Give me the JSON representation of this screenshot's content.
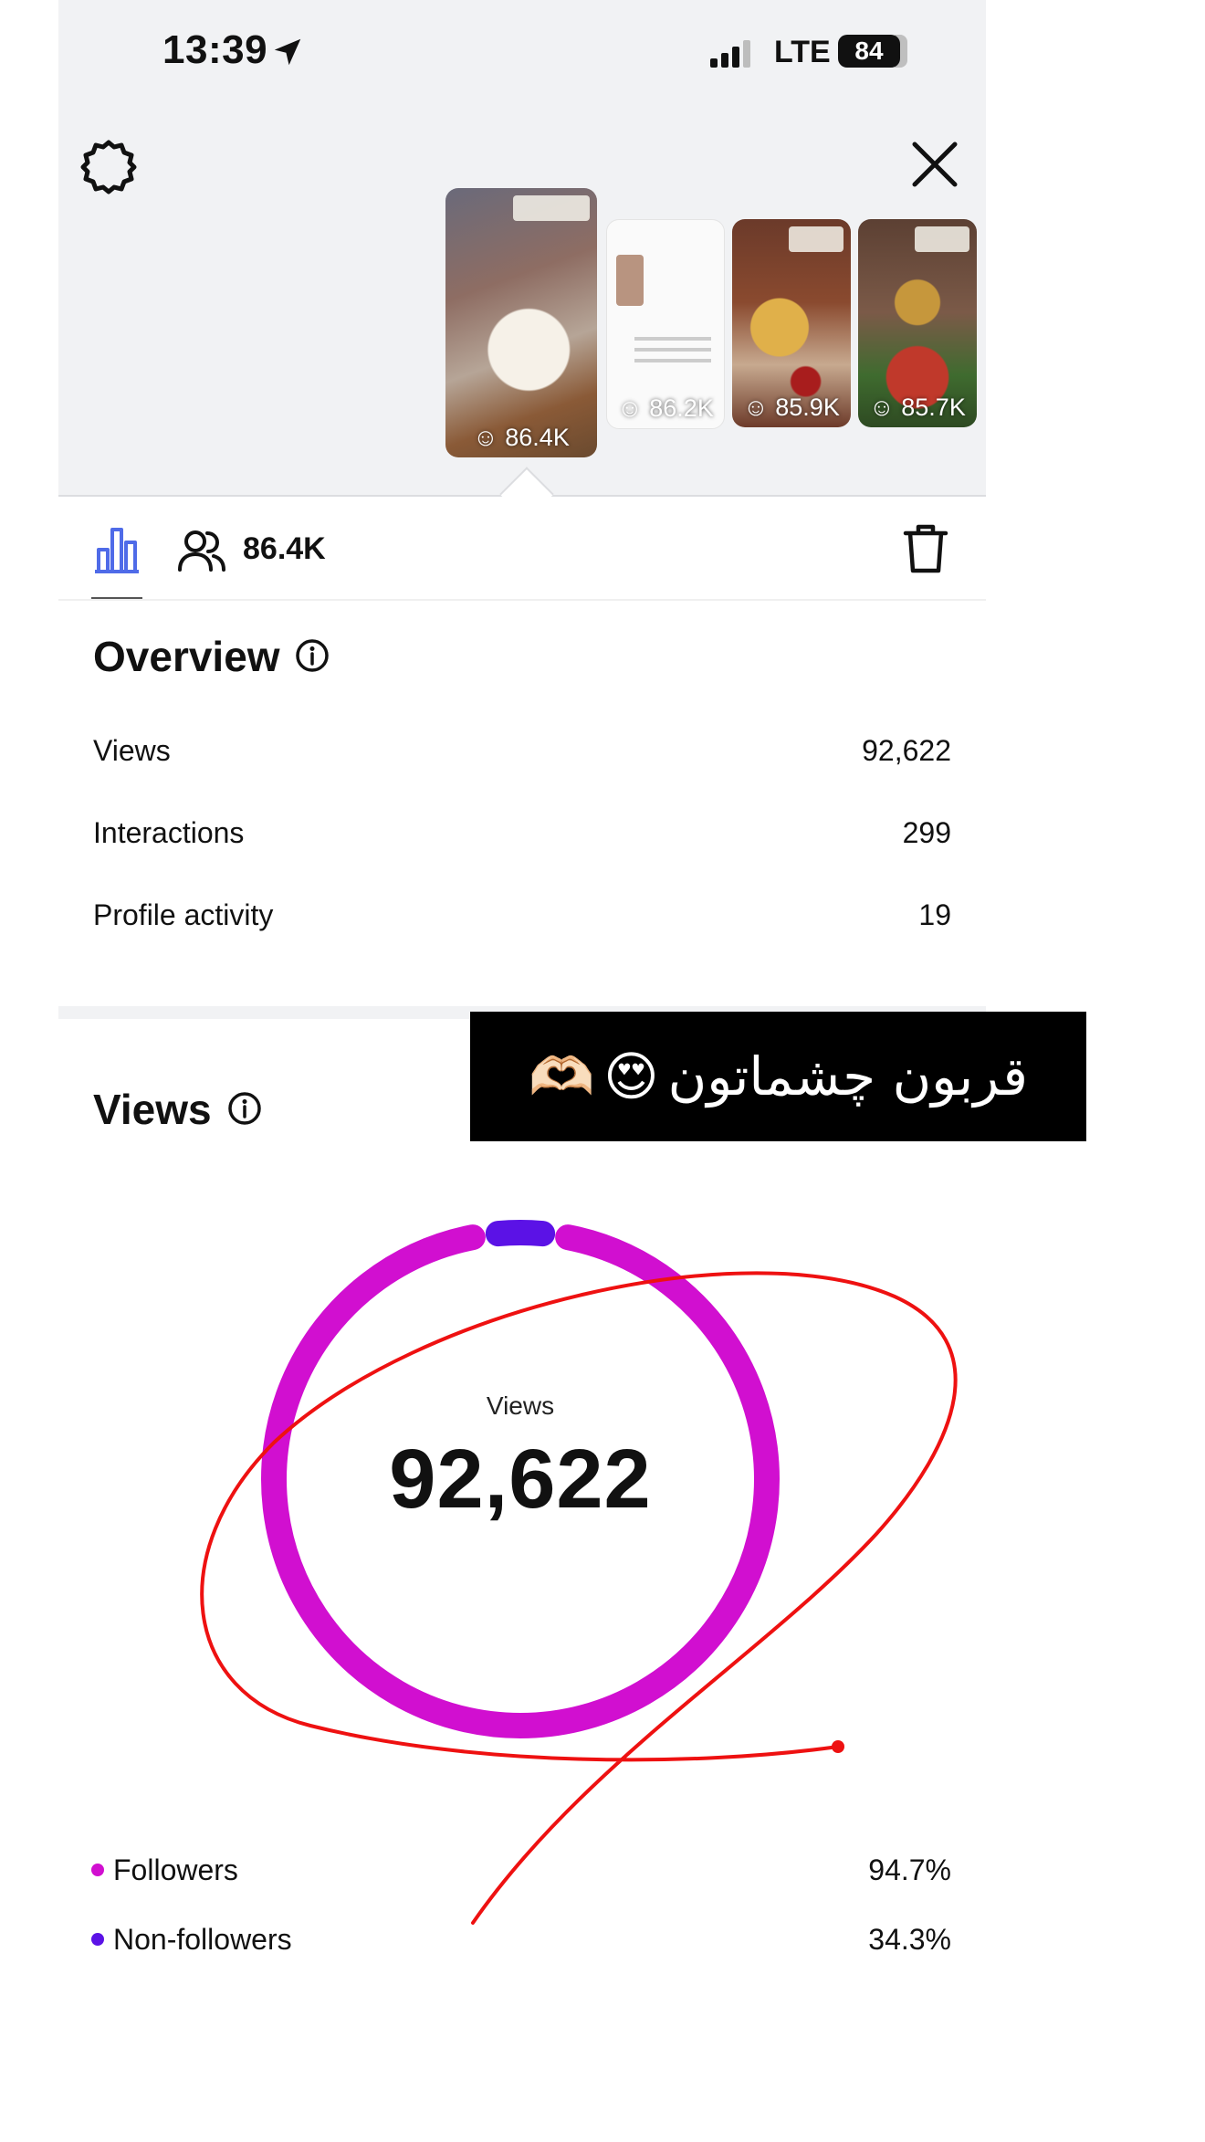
{
  "status_bar": {
    "time": "13:39",
    "network": "LTE",
    "battery": "84"
  },
  "icons": {
    "settings": "gear-icon",
    "close": "close-icon",
    "location": "location-arrow-icon",
    "signal": "signal-icon",
    "insights": "bar-chart-icon",
    "reach": "people-icon",
    "delete": "trash-icon",
    "info": "info-icon"
  },
  "stories": [
    {
      "reach": "86.4K",
      "selected": true
    },
    {
      "reach": "86.2K"
    },
    {
      "reach": "85.9K"
    },
    {
      "reach": "85.7K"
    }
  ],
  "header": {
    "reach_count": "86.4K"
  },
  "overview": {
    "title": "Overview",
    "rows": [
      {
        "label": "Views",
        "value": "92,622"
      },
      {
        "label": "Interactions",
        "value": "299"
      },
      {
        "label": "Profile activity",
        "value": "19"
      }
    ]
  },
  "views": {
    "title": "Views",
    "center_label": "Views",
    "center_value": "92,622",
    "legend": [
      {
        "label": "Followers",
        "value": "94.7%",
        "color": "#d10fd0"
      },
      {
        "label": "Non-followers",
        "value": "34.3%",
        "color": "#5b12e6"
      }
    ]
  },
  "overlay": {
    "sticker_text": "قربون چشماتون",
    "emoji": [
      "😍",
      "🫶🏻"
    ]
  },
  "chart_data": {
    "type": "pie",
    "categories": [
      "Followers",
      "Non-followers"
    ],
    "values": [
      94.7,
      34.3
    ],
    "unit": "%",
    "colors": [
      "#d10fd0",
      "#5b12e6"
    ],
    "title": "Views",
    "center_value": "92,622"
  }
}
